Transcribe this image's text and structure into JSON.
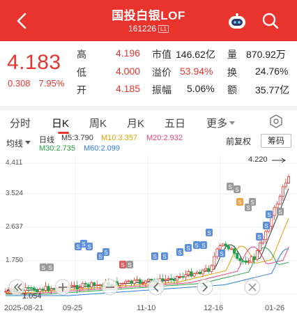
{
  "header": {
    "title": "国投白银LOF",
    "code": "161226",
    "badge": "L1",
    "color": "#e8342c"
  },
  "quote": {
    "price": "4.183",
    "change": "0.308",
    "change_pct": "7.95%",
    "rows": [
      [
        {
          "label": "高",
          "value": "4.196"
        },
        {
          "label": "市值",
          "value": "146.62亿"
        },
        {
          "label": "量",
          "value": "870.92万"
        }
      ],
      [
        {
          "label": "低",
          "value": "4.000"
        },
        {
          "label": "溢价",
          "value": "53.94%"
        },
        {
          "label": "换",
          "value": "24.76%"
        }
      ],
      [
        {
          "label": "开",
          "value": "4.185"
        },
        {
          "label": "振幅",
          "value": "5.06%"
        },
        {
          "label": "额",
          "value": "35.77亿"
        }
      ]
    ]
  },
  "tabs": [
    "分时",
    "日K",
    "周K",
    "月K",
    "五日",
    "更多"
  ],
  "active_tab": "日K",
  "indicators": {
    "dropdown": "均线",
    "name": "日线",
    "m5": "M5:3.790",
    "m10": "M10:3.357",
    "m20": "M20:2.932",
    "m30": "M30:2.735",
    "m60": "M60:2.099",
    "adjust": "前复权",
    "chip": "筹码"
  },
  "chart_data": {
    "type": "candlestick",
    "y_ticks": [
      "4.411",
      "3.524",
      "2.637",
      "1.750"
    ],
    "x_labels": [
      "2025-08-21",
      "09-25",
      "11-10",
      "12-16",
      "01-26"
    ],
    "max_label": "4.220",
    "min_label": "1.054",
    "ylim": [
      1.054,
      4.411
    ]
  }
}
